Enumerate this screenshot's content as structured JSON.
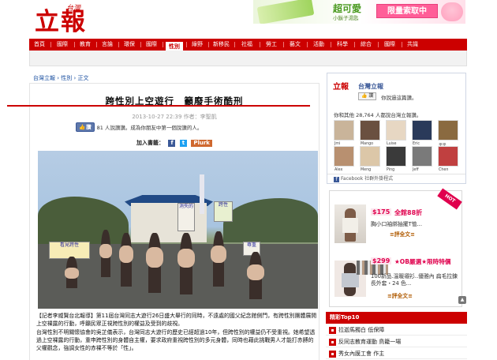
{
  "site": {
    "logo_small": "台灣",
    "logo_big": "立報"
  },
  "top_ad": {
    "brand": "超可愛",
    "product": "小鬍子湯匙",
    "deal": "限量索取中"
  },
  "nav": {
    "items": [
      "首頁",
      "國際",
      "教育",
      "言論",
      "環保",
      "國際",
      "性別",
      "綠野",
      "新移民",
      "社福",
      "勞工",
      "藝文",
      "活動",
      "科學",
      "綜合",
      "國際",
      "共識"
    ],
    "active_index": 6
  },
  "breadcrumb": "台灣立報 › 性別 › 正文",
  "article": {
    "title": "跨性別上空遊行　籲廢手術酷刑",
    "date": "2013-10-27 22:39 作者：李聖凱",
    "like_label": "讚",
    "like_text": "81 人說讚讚。成為你朋友中第一個說讚的人。",
    "share_label": "加入書籤：",
    "share_fb": "f",
    "share_tw": "t",
    "share_plurk": "Plurk",
    "photo_signs": [
      "消失的",
      "跨性",
      "看見跨性",
      "尊重"
    ],
    "body": [
      "【記者李威賢台北報導】第11屆台灣同志大遊行26日盛大舉行的同時，不遠處的國父紀念館側門，有跨性別團體展開上空裸露的行動，呼籲民眾正視跨性別的權益及受到的歧視。",
      "台灣性別不明關懷協會的吳芷儀表示，台灣同志大遊行的歷史已經超過10年，但跨性別的權益仍不受重視。她希望透過上空裸露的行動，重申跨性別的身體自主權，要求政府重視跨性別的多元身體，同時也藉此挑戰男人才能打赤膊的父權觀念，強調女性的赤裸不等於「性」。"
    ]
  },
  "fb_box": {
    "logo": "立報",
    "page_name": "台灣立報",
    "like_button": "讚",
    "like_text": "你說過這篇讚。",
    "fans_count": "你和其他 28,764 人都說台灣立報讚。",
    "fans": [
      "Jmi",
      "Mango",
      "Luise",
      "Eric",
      "平平",
      "Alex",
      "Meng",
      "Ping",
      "Jeff",
      "Chen"
    ],
    "footer": "Facebook 社群外掛程式"
  },
  "side_ad": {
    "tag": "HOT",
    "item1_price": "$175",
    "item1_title": "全館88折",
    "item1_desc": "胸小口袖綁抽擺T恤...",
    "item1_link": "≡評全文≡",
    "item2_price": "$299",
    "item2_title": "★OB嚴選★限時特價",
    "item2_desc": "100新品.溫暖襯衫..優雅內 扁毛拉鍊長外套・24 色...",
    "item2_link": "≡評全文≡"
  },
  "top10": {
    "title": "精彩Top10",
    "items": [
      "拉迦馬獨白 低保障",
      "反同志教育運動 鳥籠一場",
      "秀女內膜工會 作主"
    ]
  }
}
